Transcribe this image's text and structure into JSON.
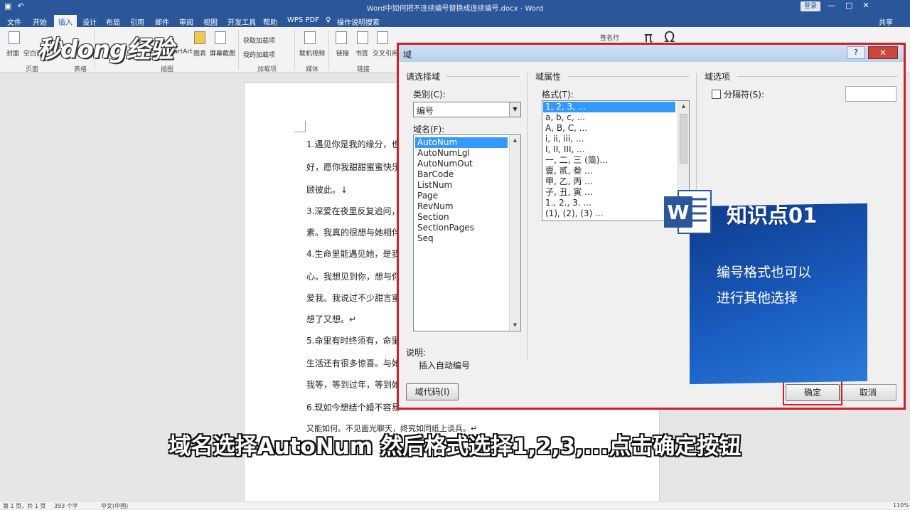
{
  "titlebar": {
    "doc_title": "Word中如何把不连续编号替换成连续编号.docx - Word",
    "login": "登录",
    "qat_save": "▣",
    "qat_undo": "↶",
    "win_min": "—",
    "win_max": "□",
    "win_close": "✕"
  },
  "menubar": {
    "tabs": [
      "文件",
      "开始",
      "插入",
      "设计",
      "布局",
      "引用",
      "邮件",
      "审阅",
      "视图",
      "开发工具",
      "帮助",
      "WPS PDF"
    ],
    "tell_me": "操作说明搜索",
    "share": "共享"
  },
  "ribbon": {
    "items": [
      "封面",
      "空白页",
      "SmartArt",
      "图表",
      "屏幕截图",
      "获取加载项",
      "我的加载项",
      "联机视频",
      "链接",
      "书签",
      "交叉引用",
      "签名行"
    ],
    "groups": [
      "页面",
      "表格",
      "插图",
      "加载项",
      "媒体",
      "链接"
    ],
    "symbols": [
      "π",
      "Ω"
    ]
  },
  "watermark": "秒dong经验",
  "document": {
    "lines": [
      "1.遇见你是我的缘分，也",
      "好，愿你我甜甜蜜蜜快乐",
      "顾彼此。↓",
      "3.深爱在夜里反复追问，",
      "素。我真的很想与她相伴",
      "4.生命里能遇见她，是我",
      "心。我想见到你，想与你",
      "爱我。我说过不少甜言蜜",
      "想了又想。↵",
      "5.命里有时终须有，命里",
      "生活还有很多惊喜。与她",
      "我等，等到过年，等到她",
      "6.现如今想结个婚不容易",
      "又能如何。不见面光聊天，终究如同纸上谈兵。↵"
    ]
  },
  "status": {
    "page": "第 1 页，共 1 页",
    "words": "393 个字",
    "lang": "中文(中国)",
    "zoom": "110%"
  },
  "dialog": {
    "title": "域",
    "help": "?",
    "close": "✕",
    "left_section": "请选择域",
    "category_label": "类别(C):",
    "category_value": "编号",
    "fieldname_label": "域名(F):",
    "field_names": [
      "AutoNum",
      "AutoNumLgl",
      "AutoNumOut",
      "BarCode",
      "ListNum",
      "Page",
      "RevNum",
      "Section",
      "SectionPages",
      "Seq"
    ],
    "selected_field": "AutoNum",
    "props_section": "域属性",
    "format_label": "格式(T):",
    "formats": [
      "1, 2, 3, ...",
      "a, b, c, ...",
      "A, B, C, ...",
      "i, ii, iii, ...",
      "I, II, III, ...",
      "一, 二, 三 (简)...",
      "壹, 贰, 叁 ...",
      "甲, 乙, 丙 ...",
      "子, 丑, 寅 ...",
      "1., 2., 3. ...",
      "(1), (2), (3) ..."
    ],
    "selected_format": "1, 2, 3, ...",
    "options_section": "域选项",
    "separator_label": "分隔符(S):",
    "desc_label": "说明:",
    "desc_text": "插入自动编号",
    "field_codes_button": "域代码(I)",
    "ok_button": "确定",
    "cancel_button": "取消"
  },
  "overlay": {
    "heading": "知识点01",
    "line1": "编号格式也可以",
    "line2": "进行其他选择",
    "logo_letter": "W"
  },
  "subtitle": "域名选择AutoNum  然后格式选择1,2,3,...点击确定按钮",
  "colors": {
    "word_blue": "#2b579a",
    "highlight_red": "#d11f2a",
    "selection_blue": "#3399ff"
  }
}
